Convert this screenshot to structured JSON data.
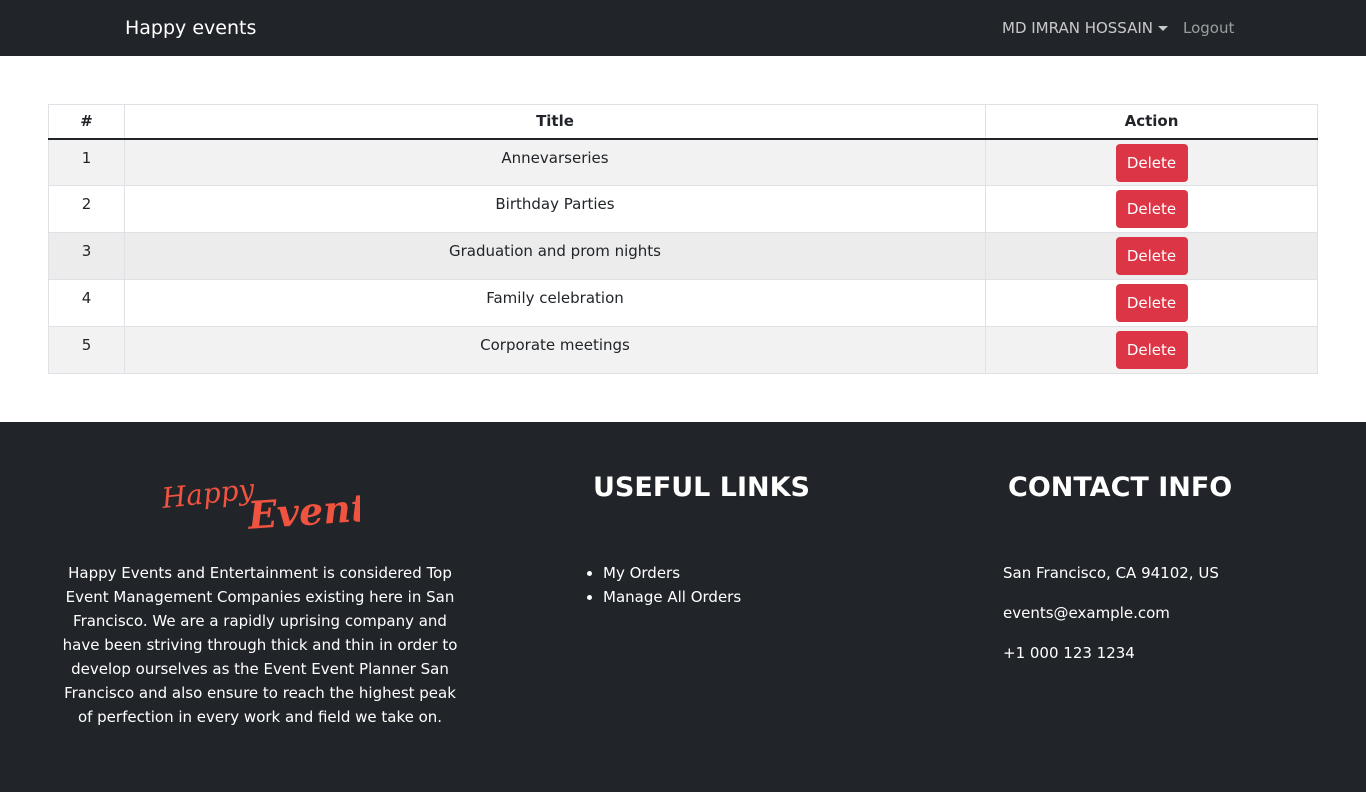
{
  "navbar": {
    "brand": "Happy events",
    "user_name": "MD IMRAN HOSSAIN",
    "logout": "Logout"
  },
  "table": {
    "headers": [
      "#",
      "Title",
      "Action"
    ],
    "rows": [
      {
        "num": "1",
        "title": "Annevarseries",
        "action": "Delete"
      },
      {
        "num": "2",
        "title": "Birthday Parties",
        "action": "Delete"
      },
      {
        "num": "3",
        "title": "Graduation and prom nights",
        "action": "Delete"
      },
      {
        "num": "4",
        "title": "Family celebration",
        "action": "Delete"
      },
      {
        "num": "5",
        "title": "Corporate meetings",
        "action": "Delete"
      }
    ]
  },
  "footer": {
    "logo_text": "Happy Events",
    "about": "Happy Events and Entertainment is considered Top Event Management Companies existing here in San Francisco. We are a rapidly uprising company and have been striving through thick and thin in order to develop ourselves as the Event Event Planner San Francisco and also ensure to reach the highest peak of perfection in every work and field we take on.",
    "useful_links_heading": "USEFUL LINKS",
    "links": [
      "My Orders",
      "Manage All Orders"
    ],
    "contact_heading": "CONTACT INFO",
    "address": "San Francisco, CA 94102, US",
    "email": "events@example.com",
    "phone": "+1 000 123 1234"
  },
  "colors": {
    "navbar_bg": "#212529",
    "delete_button": "#dc3545",
    "logo_accent": "#f0533f"
  }
}
